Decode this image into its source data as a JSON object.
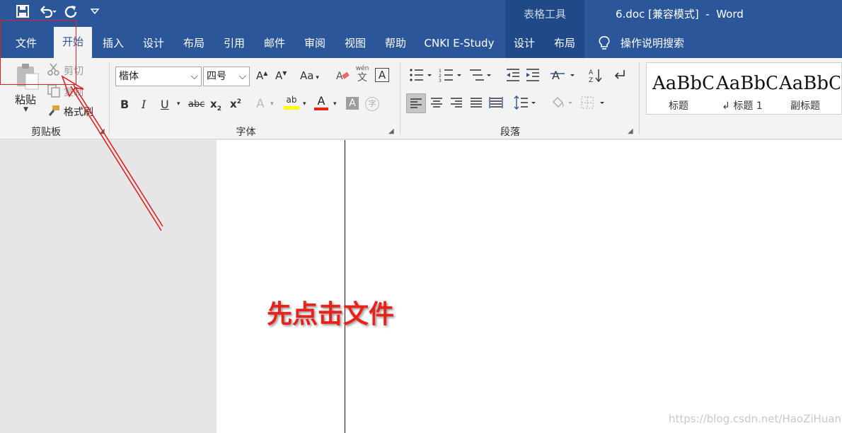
{
  "title_bar": {
    "doc_title": "6.doc [兼容模式]  -  Word",
    "context_tools_label": "表格工具"
  },
  "quick_access": {
    "icons": [
      "save-icon",
      "undo-icon",
      "redo-icon",
      "customize-icon"
    ]
  },
  "tabs": [
    {
      "label": "文件"
    },
    {
      "label": "开始"
    },
    {
      "label": "插入"
    },
    {
      "label": "设计"
    },
    {
      "label": "布局"
    },
    {
      "label": "引用"
    },
    {
      "label": "邮件"
    },
    {
      "label": "审阅"
    },
    {
      "label": "视图"
    },
    {
      "label": "帮助"
    },
    {
      "label": "CNKI E-Study"
    },
    {
      "label": "设计"
    },
    {
      "label": "布局"
    }
  ],
  "tell_me": "操作说明搜索",
  "clipboard": {
    "paste": "粘贴",
    "cut": "剪切",
    "copy": "复制",
    "format_painter": "格式刷",
    "group": "剪贴板"
  },
  "font": {
    "family": "楷体",
    "size": "四号",
    "grow": "A",
    "shrink": "A",
    "change_case": "Aa",
    "bold": "B",
    "italic": "I",
    "underline": "U",
    "strike": "abc",
    "subscript": "x",
    "subscript_mark": "2",
    "superscript": "x",
    "superscript_mark": "2",
    "text_effects": "A",
    "highlight": "ab",
    "font_color": "A",
    "char_shading": "A",
    "enclose": "字",
    "phonetic_top": "wén",
    "phonetic_char": "文",
    "border_char": "A",
    "group": "字体"
  },
  "paragraph": {
    "group": "段落"
  },
  "styles": [
    {
      "sample": "AaBbCcDd",
      "name": "标题"
    },
    {
      "sample": "AaBbCcDd",
      "name": "↲ 标题 1"
    },
    {
      "sample": "AaBbCcDd",
      "name": "副标题"
    }
  ],
  "annotation": {
    "text": "先点击文件",
    "color": "#e8211a"
  },
  "watermark": "https://blog.csdn.net/HaoZiHuang",
  "colors": {
    "ribbon_blue": "#2b579a",
    "context_blue": "#204a87",
    "highlight_yellow": "#ffff00",
    "font_red": "#e8211a"
  }
}
